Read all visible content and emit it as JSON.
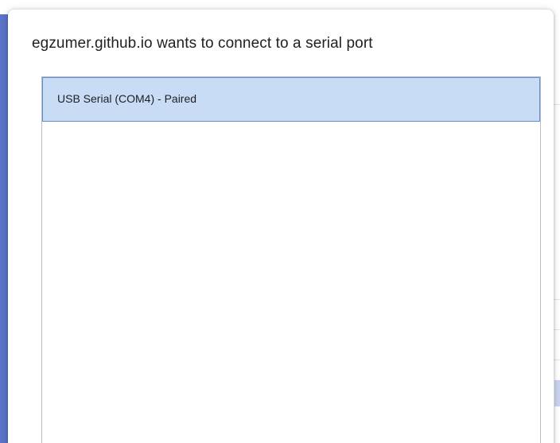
{
  "dialog": {
    "title": "egzumer.github.io wants to connect to a serial port"
  },
  "devices": [
    {
      "label": "USB Serial (COM4) - Paired",
      "selected": true
    }
  ],
  "colors": {
    "accent": "#5b73c8",
    "selected_bg": "#c8dcf5",
    "selected_border": "#5f8fd0"
  }
}
